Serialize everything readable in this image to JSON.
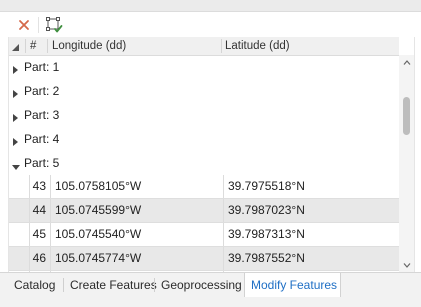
{
  "toolbar": {
    "buttons": [
      {
        "icon": "close-icon"
      },
      {
        "icon": "select-vertices-icon"
      }
    ]
  },
  "grid": {
    "columns": {
      "hash": "#",
      "longitude": "Longitude (dd)",
      "latitude": "Latitude (dd)"
    },
    "parts": [
      {
        "label": "Part: 1",
        "expanded": false
      },
      {
        "label": "Part: 2",
        "expanded": false
      },
      {
        "label": "Part: 3",
        "expanded": false
      },
      {
        "label": "Part: 4",
        "expanded": false
      },
      {
        "label": "Part: 5",
        "expanded": true
      }
    ],
    "rows": [
      {
        "index": "43",
        "lon": "105.0758105°W",
        "lat": "39.7975518°N"
      },
      {
        "index": "44",
        "lon": "105.0745599°W",
        "lat": "39.7987023°N"
      },
      {
        "index": "45",
        "lon": "105.0745540°W",
        "lat": "39.7987313°N"
      },
      {
        "index": "46",
        "lon": "105.0745774°W",
        "lat": "39.7987552°N"
      },
      {
        "index": "",
        "lon": "",
        "lat": ""
      }
    ],
    "scroll": {
      "thumb_start": 0.15,
      "thumb_size": 0.2
    }
  },
  "tabs": [
    {
      "label": "Catalog",
      "active": false
    },
    {
      "label": "Create Features",
      "active": false
    },
    {
      "label": "Geoprocessing",
      "active": false
    },
    {
      "label": "Modify Features",
      "active": true
    }
  ],
  "colors": {
    "accent": "#1f6fc5",
    "close_icon": "#d5694a",
    "vertex_icon": "#3f8f3f"
  }
}
